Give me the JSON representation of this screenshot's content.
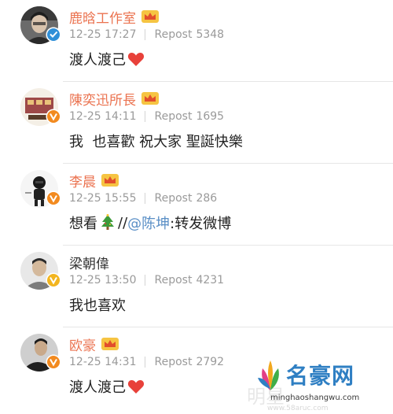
{
  "posts": [
    {
      "name": "鹿晗工作室",
      "name_color": "#eb7350",
      "date": "12-25 17:27",
      "repost_label": "Repost",
      "repost_count": "5348",
      "text": "渡人渡己",
      "emoji": "heart"
    },
    {
      "name": "陳奕迅所長",
      "name_color": "#eb7350",
      "date": "12-25 14:11",
      "repost_label": "Repost",
      "repost_count": "1695",
      "text": "我  也喜歡 祝大家 聖誕快樂"
    },
    {
      "name": "李晨",
      "name_color": "#eb7350",
      "date": "12-25 15:55",
      "repost_label": "Repost",
      "repost_count": "286",
      "text_before": "想看",
      "emoji": "christmas-tree",
      "text_slashes": "//",
      "mention": "@陈坤",
      "text_after": ":转发微博"
    },
    {
      "name": "梁朝偉",
      "name_color": "#333333",
      "date": "12-25 13:50",
      "repost_label": "Repost",
      "repost_count": "4231",
      "text": "我也喜欢"
    },
    {
      "name": "欧豪",
      "name_color": "#eb7350",
      "date": "12-25 14:31",
      "repost_label": "Repost",
      "repost_count": "2792",
      "text": "渡人渡己",
      "emoji": "heart"
    }
  ],
  "watermark": {
    "brand": "名豪网",
    "url": "minghaoshangwu.com",
    "faint_text": "明星",
    "faint_url": "www.58aruc.com"
  },
  "colors": {
    "name_accent": "#eb7350",
    "meta_gray": "#9a9a9a",
    "mention_blue": "#5a8fc6",
    "verify_orange": "#f28a1f",
    "verify_blue": "#2f8fd8",
    "heart_red": "#e8413a"
  }
}
